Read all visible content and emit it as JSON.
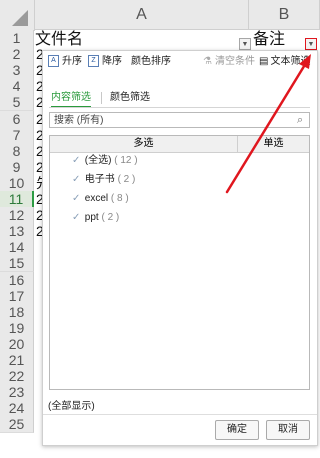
{
  "sheet": {
    "columns": [
      "A",
      "B"
    ],
    "rows": [
      "1",
      "2",
      "3",
      "4",
      "5",
      "6",
      "7",
      "8",
      "9",
      "10",
      "11",
      "12",
      "13",
      "14",
      "15",
      "16",
      "17",
      "18",
      "19",
      "20",
      "21",
      "22",
      "23",
      "24",
      "25"
    ],
    "active_row": "11",
    "a1": "文件名",
    "b1": "备注",
    "a_peek": [
      "2",
      "2",
      "2",
      "2",
      "2",
      "2",
      "2",
      "2",
      "先",
      "2",
      "2",
      "2"
    ]
  },
  "filter_panel": {
    "toolbar": {
      "asc": "升序",
      "desc": "降序",
      "color_sort": "颜色排序",
      "clear": "清空条件",
      "text_filter": "文本筛选"
    },
    "tabs": [
      "内容筛选",
      "颜色筛选"
    ],
    "search_placeholder": "搜索 (所有)",
    "list": {
      "col_multi": "多选",
      "col_single": "单选",
      "items": [
        {
          "label": "(全选)",
          "count": "( 12 )"
        },
        {
          "label": "电子书",
          "count": "( 2 )"
        },
        {
          "label": "excel",
          "count": "( 8 )"
        },
        {
          "label": "ppt",
          "count": "( 2 )"
        }
      ]
    },
    "show_all": "(全部显示)",
    "ok": "确定",
    "cancel": "取消"
  },
  "colors": {
    "accent": "#2a9a3c",
    "arrow": "#e0161e"
  }
}
